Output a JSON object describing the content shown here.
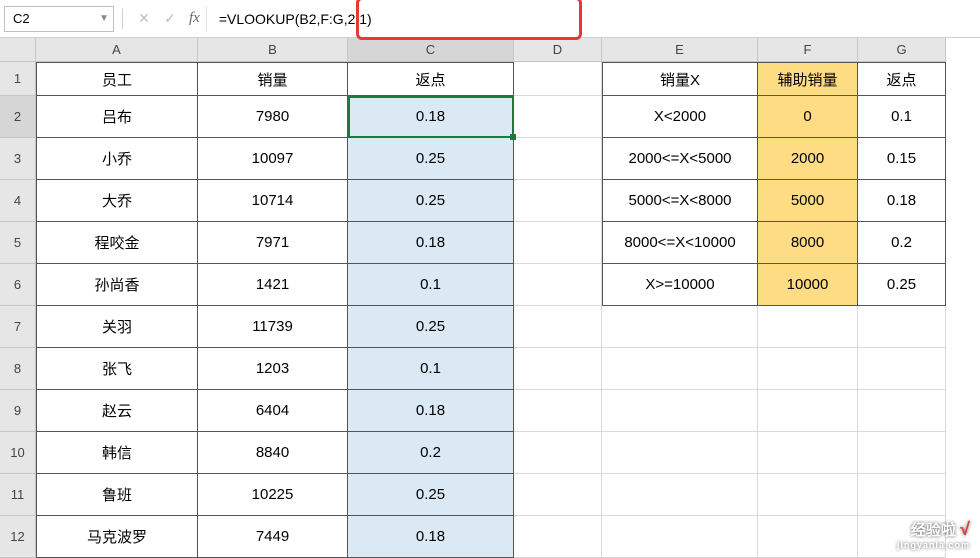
{
  "nameBox": "C2",
  "formula": "=VLOOKUP(B2,F:G,2,1)",
  "columnHeaders": [
    "A",
    "B",
    "C",
    "D",
    "E",
    "F",
    "G"
  ],
  "rowHeaders": [
    "1",
    "2",
    "3",
    "4",
    "5",
    "6",
    "7",
    "8",
    "9",
    "10",
    "11",
    "12"
  ],
  "tableA": {
    "headers": {
      "A": "员工",
      "B": "销量",
      "C": "返点"
    },
    "rows": [
      {
        "A": "吕布",
        "B": "7980",
        "C": "0.18"
      },
      {
        "A": "小乔",
        "B": "10097",
        "C": "0.25"
      },
      {
        "A": "大乔",
        "B": "10714",
        "C": "0.25"
      },
      {
        "A": "程咬金",
        "B": "7971",
        "C": "0.18"
      },
      {
        "A": "孙尚香",
        "B": "1421",
        "C": "0.1"
      },
      {
        "A": "关羽",
        "B": "11739",
        "C": "0.25"
      },
      {
        "A": "张飞",
        "B": "1203",
        "C": "0.1"
      },
      {
        "A": "赵云",
        "B": "6404",
        "C": "0.18"
      },
      {
        "A": "韩信",
        "B": "8840",
        "C": "0.2"
      },
      {
        "A": "鲁班",
        "B": "10225",
        "C": "0.25"
      },
      {
        "A": "马克波罗",
        "B": "7449",
        "C": "0.18"
      }
    ]
  },
  "tableB": {
    "headers": {
      "E": "销量X",
      "F": "辅助销量",
      "G": "返点"
    },
    "rows": [
      {
        "E": "X<2000",
        "F": "0",
        "G": "0.1"
      },
      {
        "E": "2000<=X<5000",
        "F": "2000",
        "G": "0.15"
      },
      {
        "E": "5000<=X<8000",
        "F": "5000",
        "G": "0.18"
      },
      {
        "E": "8000<=X<10000",
        "F": "8000",
        "G": "0.2"
      },
      {
        "E": "X>=10000",
        "F": "10000",
        "G": "0.25"
      }
    ]
  },
  "watermark": {
    "main": "经验啦",
    "check": "√",
    "sub": "jingyanla.com"
  }
}
